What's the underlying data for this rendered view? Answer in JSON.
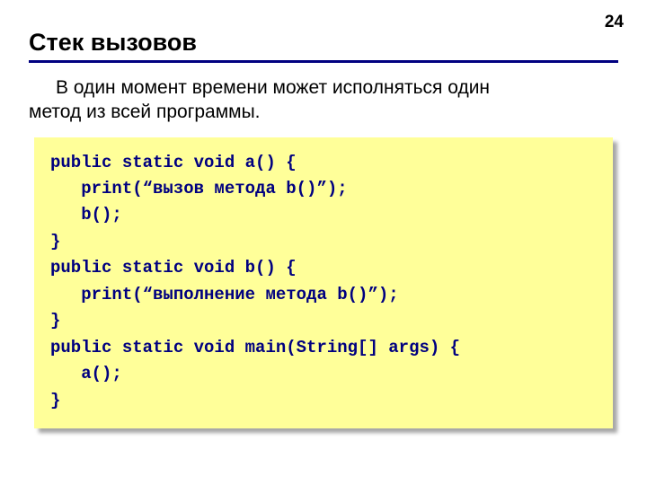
{
  "page_number": "24",
  "title": "Стек вызовов",
  "body_text_line1": "В один момент времени может исполняться один",
  "body_text_line2": "метод из всей программы.",
  "code": {
    "l01": "public static void a() {",
    "l02": "   print(“вызов метода b()”);",
    "l03": "   b();",
    "l04": "}",
    "l05": "public static void b() {",
    "l06": "   print(“выполнение метода b()”);",
    "l07": "}",
    "l08": "public static void main(String[] args) {",
    "l09": "   a();",
    "l10": "}"
  }
}
